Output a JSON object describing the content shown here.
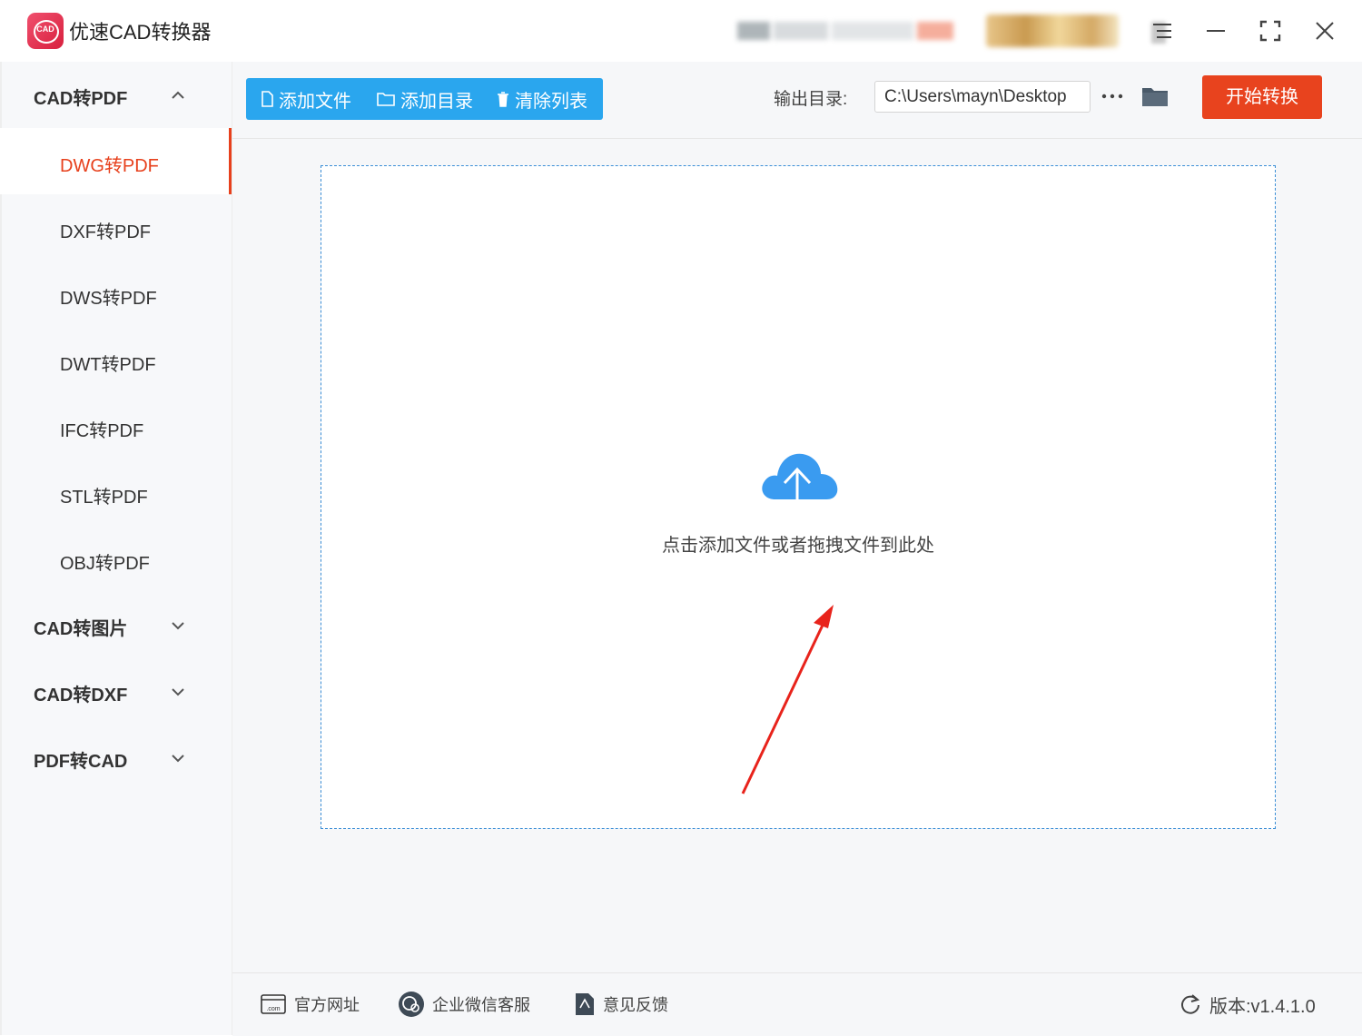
{
  "app": {
    "title": "优速CAD转换器",
    "logo_text": "CAD"
  },
  "colors": {
    "accent_red": "#e8431e",
    "toolbar_blue": "#2aa6ee",
    "active_item": "#e7401c",
    "dropzone_border": "#3b8ed6",
    "cloud_blue": "#3a9bf0"
  },
  "sidebar": {
    "groups": [
      {
        "label": "CAD转PDF",
        "expanded": true,
        "items": [
          {
            "label": "DWG转PDF",
            "active": true
          },
          {
            "label": "DXF转PDF",
            "active": false
          },
          {
            "label": "DWS转PDF",
            "active": false
          },
          {
            "label": "DWT转PDF",
            "active": false
          },
          {
            "label": "IFC转PDF",
            "active": false
          },
          {
            "label": "STL转PDF",
            "active": false
          },
          {
            "label": "OBJ转PDF",
            "active": false
          }
        ]
      },
      {
        "label": "CAD转图片",
        "expanded": false
      },
      {
        "label": "CAD转DXF",
        "expanded": false
      },
      {
        "label": "PDF转CAD",
        "expanded": false
      }
    ]
  },
  "toolbar": {
    "add_file": "添加文件",
    "add_folder": "添加目录",
    "clear_list": "清除列表",
    "output_label": "输出目录:",
    "output_path": "C:\\Users\\mayn\\Desktop",
    "start_button": "开始转换"
  },
  "dropzone": {
    "hint": "点击添加文件或者拖拽文件到此处",
    "icon": "cloud-upload-icon"
  },
  "footer": {
    "website": "官方网址",
    "wechat_service": "企业微信客服",
    "feedback": "意见反馈",
    "version": "版本:v1.4.1.0"
  }
}
